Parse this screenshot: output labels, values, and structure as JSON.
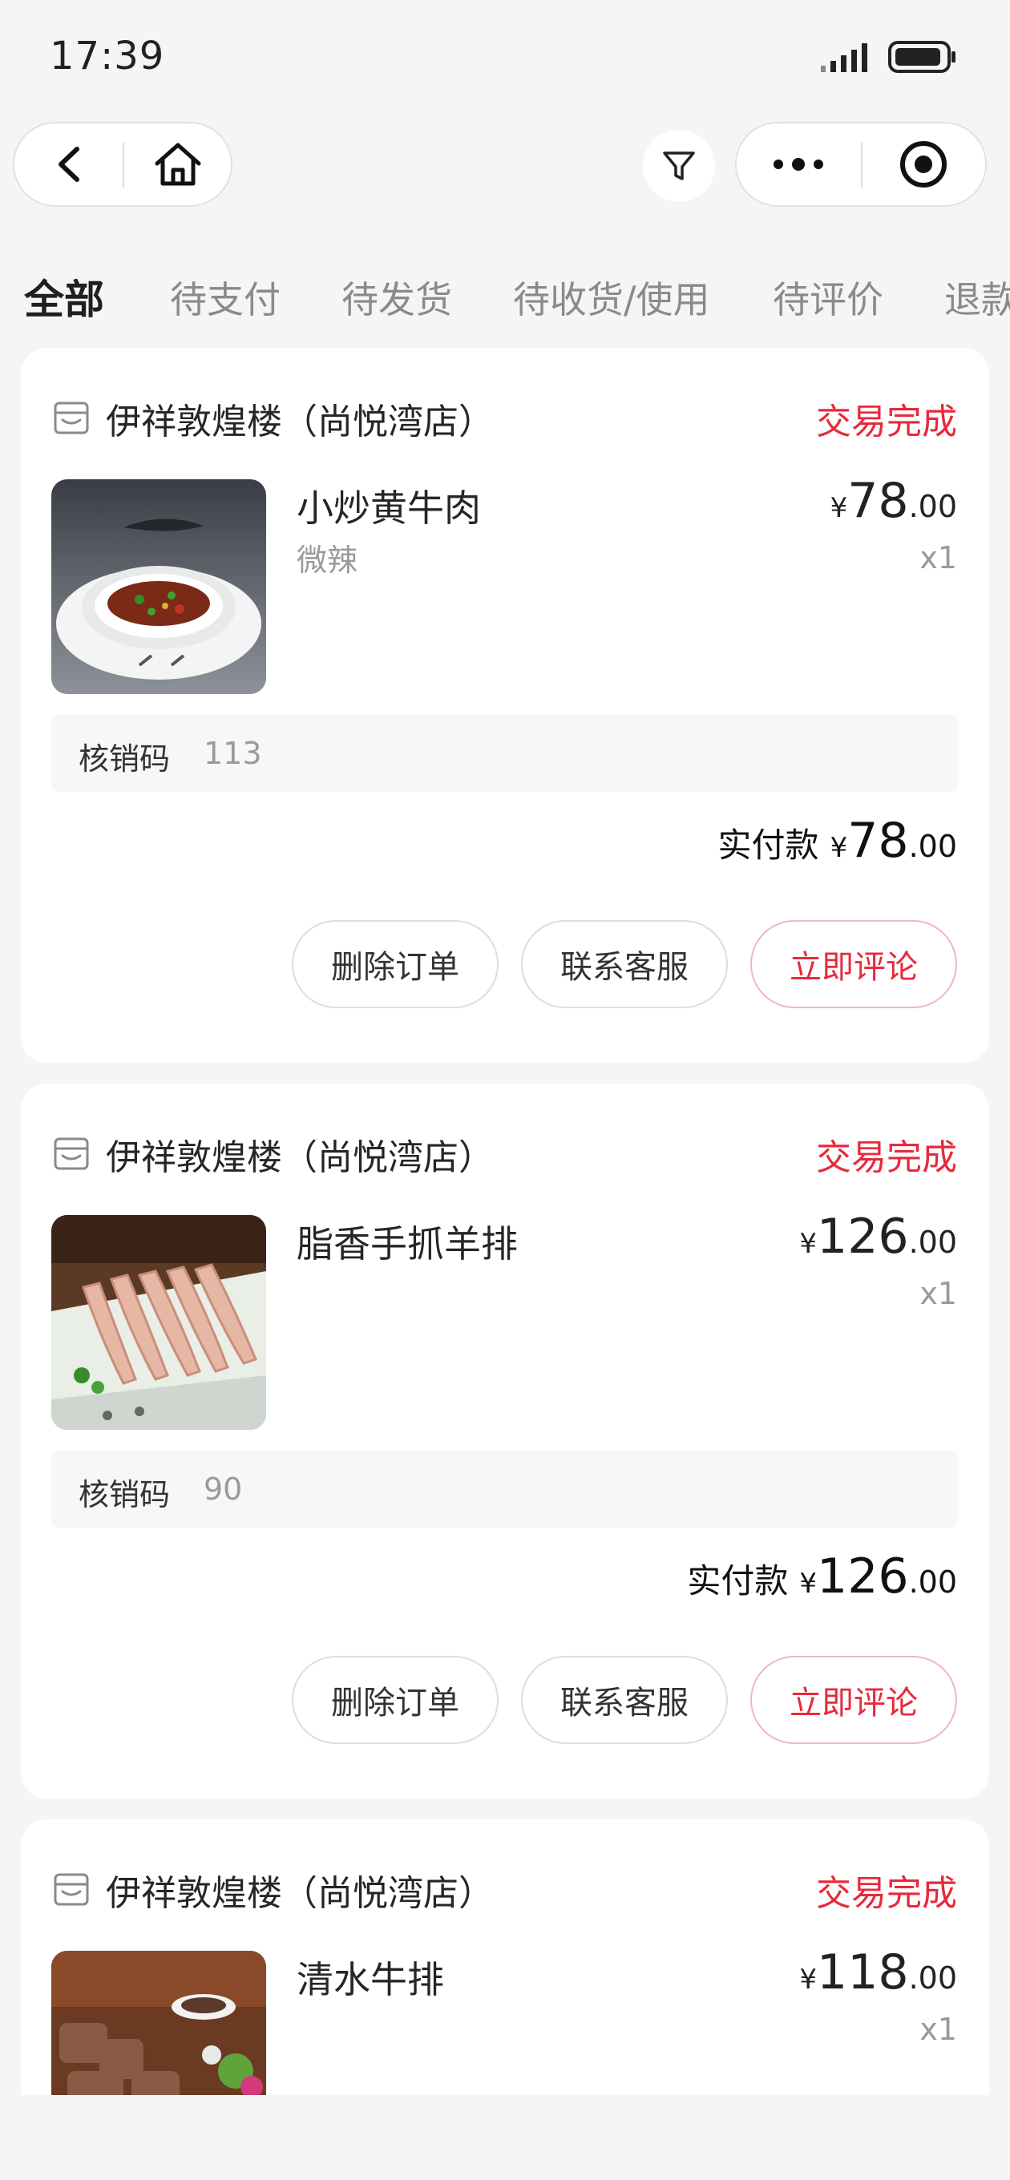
{
  "status_bar": {
    "time": "17:39"
  },
  "tabs": [
    "全部",
    "待支付",
    "待发货",
    "待收货/使用",
    "待评价",
    "退款"
  ],
  "orders": [
    {
      "store_name": "伊祥敦煌楼（尚悦湾店）",
      "status": "交易完成",
      "product_name": "小炒黄牛肉",
      "spec": "微辣",
      "price_currency": "¥",
      "price_int": "78",
      "price_dec": ".00",
      "quantity": "x1",
      "verify_label": "核销码",
      "verify_code": "113",
      "paid_label": "实付款",
      "paid_currency": "¥",
      "paid_int": "78",
      "paid_dec": ".00",
      "buttons": {
        "delete": "删除订单",
        "contact": "联系客服",
        "review": "立即评论"
      }
    },
    {
      "store_name": "伊祥敦煌楼（尚悦湾店）",
      "status": "交易完成",
      "product_name": "脂香手抓羊排",
      "spec": "",
      "price_currency": "¥",
      "price_int": "126",
      "price_dec": ".00",
      "quantity": "x1",
      "verify_label": "核销码",
      "verify_code": "90",
      "paid_label": "实付款",
      "paid_currency": "¥",
      "paid_int": "126",
      "paid_dec": ".00",
      "buttons": {
        "delete": "删除订单",
        "contact": "联系客服",
        "review": "立即评论"
      }
    },
    {
      "store_name": "伊祥敦煌楼（尚悦湾店）",
      "status": "交易完成",
      "product_name": "清水牛排",
      "spec": "",
      "price_currency": "¥",
      "price_int": "118",
      "price_dec": ".00",
      "quantity": "x1"
    }
  ],
  "colors": {
    "accent": "#e8293b",
    "background": "#f5f5f5",
    "card": "#ffffff"
  }
}
